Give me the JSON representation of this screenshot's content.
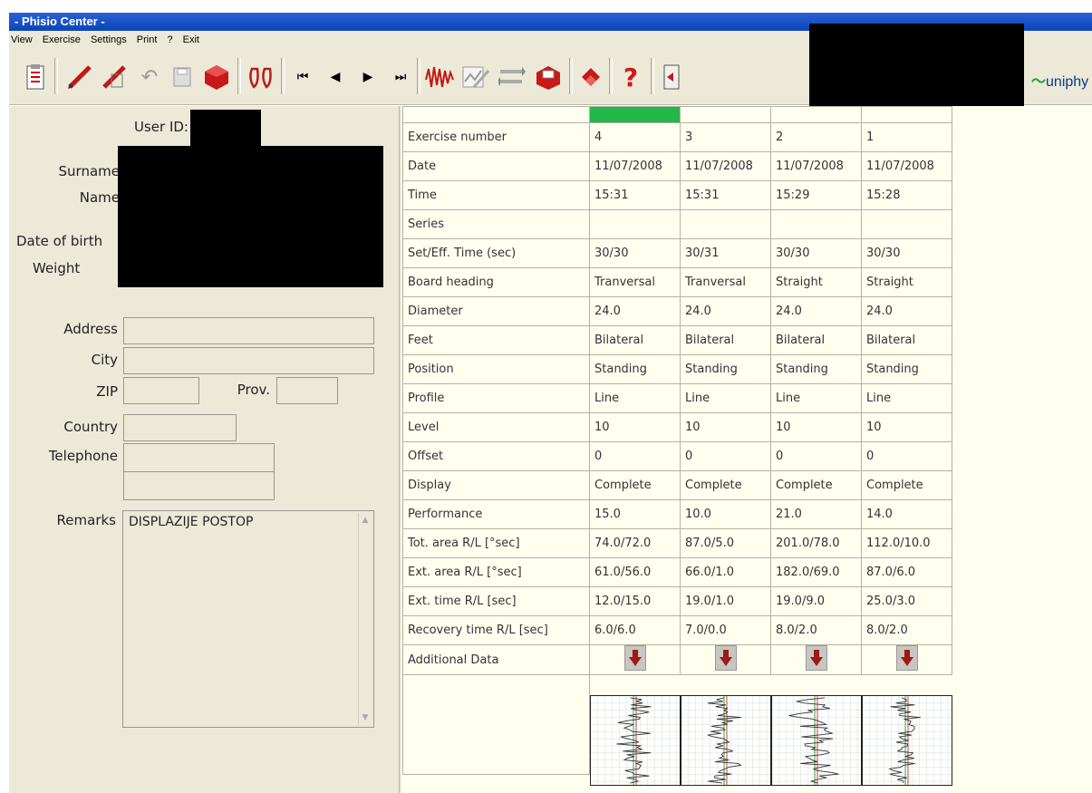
{
  "window": {
    "title": "- Phisio Center -"
  },
  "menu": [
    "View",
    "Exercise",
    "Settings",
    "Print",
    "?",
    "Exit"
  ],
  "toolbar": {
    "icons": [
      "clipboard-icon",
      "pencil-icon",
      "pencil-edit-icon",
      "undo-icon",
      "floppy-disk-icon",
      "red-cube-icon",
      "footprints-icon",
      "first-record-icon",
      "previous-record-icon",
      "next-record-icon",
      "last-record-icon",
      "waveform-icon",
      "chart-edit-icon",
      "transfer-icon",
      "red-box-icon",
      "book-icon",
      "help-icon",
      "exit-door-icon"
    ],
    "logo_text": "uniphy",
    "nav_glyphs": {
      "first": "⏮",
      "prev": "◀",
      "next": "▶",
      "last": "⏭"
    },
    "help_glyph": "?"
  },
  "patient": {
    "labels": {
      "user_id": "User ID:",
      "surname": "Surname",
      "name": "Name",
      "dob": "Date of birth",
      "weight": "Weight",
      "address": "Address",
      "city": "City",
      "zip": "ZIP",
      "prov": "Prov.",
      "country": "Country",
      "telephone": "Telephone",
      "remarks": "Remarks"
    },
    "remarks_value": "DISPLAZIJE POSTOP"
  },
  "exercises": {
    "row_labels": [
      "Exercise number",
      "Date",
      "Time",
      "Series",
      "Set/Eff. Time (sec)",
      "Board heading",
      "Diameter",
      "Feet",
      "Position",
      "Profile",
      "Level",
      "Offset",
      "Display",
      "Performance",
      "Tot. area R/L [°sec]",
      "Ext. area R/L [°sec]",
      "Ext. time R/L [sec]",
      "Recovery time R/L [sec]",
      "Additional Data"
    ],
    "columns": [
      [
        "4",
        "11/07/2008",
        "15:31",
        "",
        "30/30",
        "Tranversal",
        "24.0",
        "Bilateral",
        "Standing",
        "Line",
        "10",
        "0",
        "Complete",
        "15.0",
        "74.0/72.0",
        "61.0/56.0",
        "12.0/15.0",
        "6.0/6.0"
      ],
      [
        "3",
        "11/07/2008",
        "15:31",
        "",
        "30/31",
        "Tranversal",
        "24.0",
        "Bilateral",
        "Standing",
        "Line",
        "10",
        "0",
        "Complete",
        "10.0",
        "87.0/5.0",
        "66.0/1.0",
        "19.0/1.0",
        "7.0/0.0"
      ],
      [
        "2",
        "11/07/2008",
        "15:29",
        "",
        "30/30",
        "Straight",
        "24.0",
        "Bilateral",
        "Standing",
        "Line",
        "10",
        "0",
        "Complete",
        "21.0",
        "201.0/78.0",
        "182.0/69.0",
        "19.0/9.0",
        "8.0/2.0"
      ],
      [
        "1",
        "11/07/2008",
        "15:28",
        "",
        "30/30",
        "Straight",
        "24.0",
        "Bilateral",
        "Standing",
        "Line",
        "10",
        "0",
        "Complete",
        "14.0",
        "112.0/10.0",
        "87.0/6.0",
        "25.0/3.0",
        "8.0/2.0"
      ]
    ]
  },
  "colors": {
    "active_column": "#22b84a",
    "arrow": "#a01818",
    "grid_bg": "#fffff0"
  }
}
